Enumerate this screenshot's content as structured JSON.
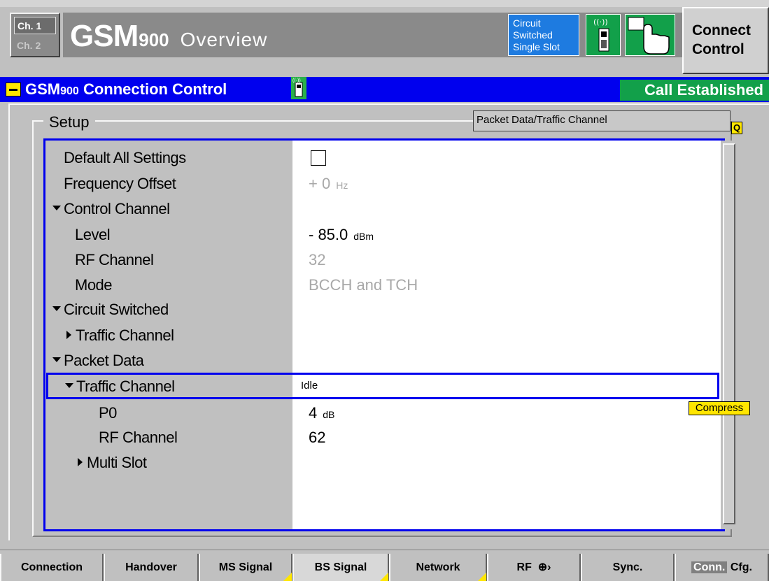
{
  "header": {
    "ch1": "Ch. 1",
    "ch2": "Ch. 2",
    "title_main": "GSM",
    "title_band": "900",
    "title_view": "Overview",
    "mode_line1": "Circuit",
    "mode_line2": "Switched",
    "mode_line3": "Single Slot",
    "connect_line1": "Connect",
    "connect_line2": "Control"
  },
  "titlebar": {
    "title_main": "GSM",
    "title_band": "900",
    "title_rest": "Connection Control",
    "call_status": "Call Established"
  },
  "panel": {
    "legend": "Setup",
    "context_box": "Packet Data/Traffic Channel",
    "q_badge": "Q",
    "compress": "Compress"
  },
  "rows": [
    {
      "label": "Default All Settings"
    },
    {
      "label": "Frequency Offset",
      "value": "+ 0",
      "unit": "Hz"
    },
    {
      "label": "Control Channel"
    },
    {
      "label": "Level",
      "value": "- 85.0",
      "unit": "dBm"
    },
    {
      "label": "RF Channel",
      "value": "32"
    },
    {
      "label": "Mode",
      "value": "BCCH and TCH"
    },
    {
      "label": "Circuit Switched"
    },
    {
      "label": "Traffic Channel"
    },
    {
      "label": "Packet Data"
    },
    {
      "label": "Traffic Channel",
      "value": "Idle"
    },
    {
      "label": "P0",
      "value": "4",
      "unit": "dB"
    },
    {
      "label": "RF Channel",
      "value": "62"
    },
    {
      "label": "Multi Slot"
    }
  ],
  "softkeys": {
    "connection": "Connection",
    "handover": "Handover",
    "ms_signal": "MS Signal",
    "bs_signal": "BS Signal",
    "network": "Network",
    "rf": "RF",
    "sync": "Sync.",
    "conn_tag": "Conn.",
    "cfg": "Cfg."
  },
  "colors": {
    "accent_blue": "#0000ee",
    "status_green": "#12a04a",
    "mode_blue": "#1e7be0",
    "highlight_yellow": "#ffe600"
  },
  "icons": [
    "minimize-icon",
    "phone-signal-icon",
    "hand-pointer-icon",
    "rf-connector-icon",
    "expand-triangle-icon",
    "collapse-triangle-icon"
  ]
}
